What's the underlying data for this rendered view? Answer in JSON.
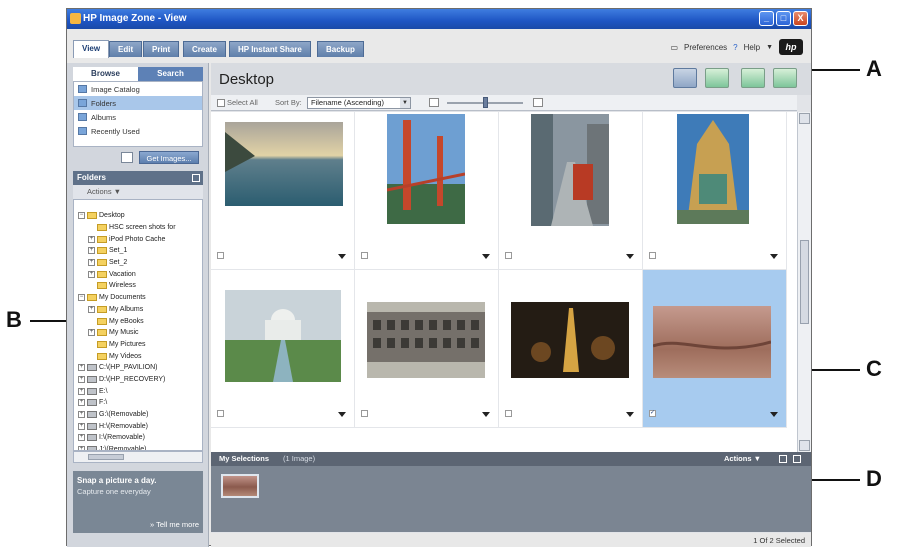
{
  "window": {
    "title": "HP Image Zone - View",
    "controls": [
      "_",
      "□",
      "X"
    ]
  },
  "tabs": [
    "View",
    "Edit",
    "Print",
    "Create",
    "HP Instant Share",
    "Backup"
  ],
  "top_right": {
    "preferences": "Preferences",
    "help": "Help",
    "help_arrow": "▼",
    "logo": "hp"
  },
  "left_panel": {
    "subtabs": [
      "Browse",
      "Search"
    ],
    "nav_items": [
      "Image Catalog",
      "Folders",
      "Albums",
      "Recently Used"
    ],
    "get_images": "Get Images...",
    "folders_header": "Folders",
    "actions": "Actions ▼",
    "tree": [
      {
        "pm": "−",
        "indent": 0,
        "icon": "folder",
        "label": "Desktop"
      },
      {
        "pm": "",
        "indent": 1,
        "icon": "folder",
        "label": "HSC screen shots for"
      },
      {
        "pm": "+",
        "indent": 1,
        "icon": "folder",
        "label": "iPod Photo Cache"
      },
      {
        "pm": "+",
        "indent": 1,
        "icon": "folder",
        "label": "Set_1"
      },
      {
        "pm": "+",
        "indent": 1,
        "icon": "folder",
        "label": "Set_2"
      },
      {
        "pm": "+",
        "indent": 1,
        "icon": "folder",
        "label": "Vacation"
      },
      {
        "pm": "",
        "indent": 1,
        "icon": "folder",
        "label": "Wireless"
      },
      {
        "pm": "−",
        "indent": 0,
        "icon": "folder",
        "label": "My Documents"
      },
      {
        "pm": "+",
        "indent": 1,
        "icon": "folder",
        "label": "My Albums"
      },
      {
        "pm": "",
        "indent": 1,
        "icon": "folder",
        "label": "My eBooks"
      },
      {
        "pm": "+",
        "indent": 1,
        "icon": "folder",
        "label": "My Music"
      },
      {
        "pm": "",
        "indent": 1,
        "icon": "folder",
        "label": "My Pictures"
      },
      {
        "pm": "",
        "indent": 1,
        "icon": "folder",
        "label": "My Videos"
      },
      {
        "pm": "+",
        "indent": 0,
        "icon": "drive",
        "label": "C:\\(HP_PAVILION)"
      },
      {
        "pm": "+",
        "indent": 0,
        "icon": "drive",
        "label": "D:\\(HP_RECOVERY)"
      },
      {
        "pm": "+",
        "indent": 0,
        "icon": "drive",
        "label": "E:\\"
      },
      {
        "pm": "+",
        "indent": 0,
        "icon": "drive",
        "label": "F:\\"
      },
      {
        "pm": "+",
        "indent": 0,
        "icon": "drive",
        "label": "G:\\(Removable)"
      },
      {
        "pm": "+",
        "indent": 0,
        "icon": "drive",
        "label": "H:\\(Removable)"
      },
      {
        "pm": "+",
        "indent": 0,
        "icon": "drive",
        "label": "I:\\(Removable)"
      },
      {
        "pm": "+",
        "indent": 0,
        "icon": "drive",
        "label": "J:\\(Removable)"
      }
    ],
    "tip": {
      "heading": "Snap a picture a day.",
      "text": "Capture one everyday",
      "more": "» Tell me more"
    }
  },
  "main": {
    "title": "Desktop",
    "toolbar": {
      "select_all": "Select All",
      "sort_by": "Sort By:",
      "sort_value": "Filename (Ascending)"
    },
    "photos": [
      {
        "name": "seascape",
        "checked": false,
        "selected": false
      },
      {
        "name": "golden-gate-bridge",
        "checked": false,
        "selected": false
      },
      {
        "name": "city-street-tram",
        "checked": false,
        "selected": false
      },
      {
        "name": "temple",
        "checked": false,
        "selected": false
      },
      {
        "name": "taj-mahal",
        "checked": false,
        "selected": false
      },
      {
        "name": "colosseum",
        "checked": false,
        "selected": false
      },
      {
        "name": "eiffel-tower-night",
        "checked": false,
        "selected": false
      },
      {
        "name": "canyon-aerial",
        "checked": true,
        "selected": true
      }
    ],
    "my_selections": {
      "label": "My Selections",
      "count": "(1 Image)",
      "actions": "Actions ▼"
    },
    "status": "1 Of 2 Selected"
  },
  "callouts": [
    "A",
    "B",
    "C",
    "D"
  ],
  "colors": {
    "accent": "#5d81b6",
    "selection": "#a7cbef",
    "titlebar": "#1e55c3"
  }
}
